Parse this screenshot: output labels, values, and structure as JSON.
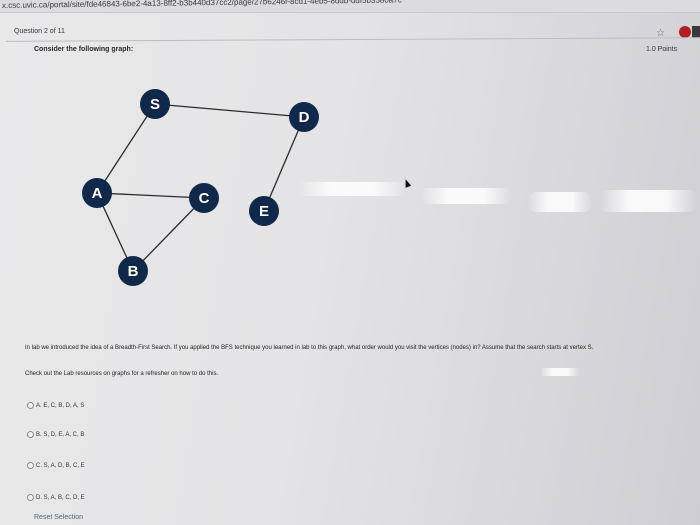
{
  "browser": {
    "url": "x.csc.uvic.ca/portal/site/fde46843-6be2-4a13-8ff2-b3b440d37cc2/page/27b6246f-8cd1-4eb5-8ddb-ddf5b3580a7c"
  },
  "question": {
    "number": "Question 2 of 11",
    "points": "1.0 Points",
    "prompt": "Consider the following graph:",
    "text": "In lab we introduced the idea of a Breadth-First Search. If you applied the BFS technique you learned in lab to this graph, what order would you visit the vertices (nodes) in? Assume that the search starts at vertex S.",
    "hint": "Check out the Lab resources on graphs for a refresher on how to do this.",
    "options": [
      "A. E, C, B, D, A, S",
      "B. S, D, E, A, C, B",
      "C. S, A, D, B, C, E",
      "D. S, A, B, C, D, E"
    ],
    "reset_label": "Reset Selection"
  },
  "graph": {
    "node_color": "#10294a",
    "nodes": [
      "S",
      "D",
      "A",
      "C",
      "E",
      "B"
    ],
    "edges": [
      [
        "S",
        "D"
      ],
      [
        "S",
        "A"
      ],
      [
        "A",
        "C"
      ],
      [
        "A",
        "B"
      ],
      [
        "B",
        "C"
      ],
      [
        "D",
        "E"
      ]
    ]
  },
  "icons": [
    "star-icon",
    "extension-icon",
    "menu-icon"
  ]
}
